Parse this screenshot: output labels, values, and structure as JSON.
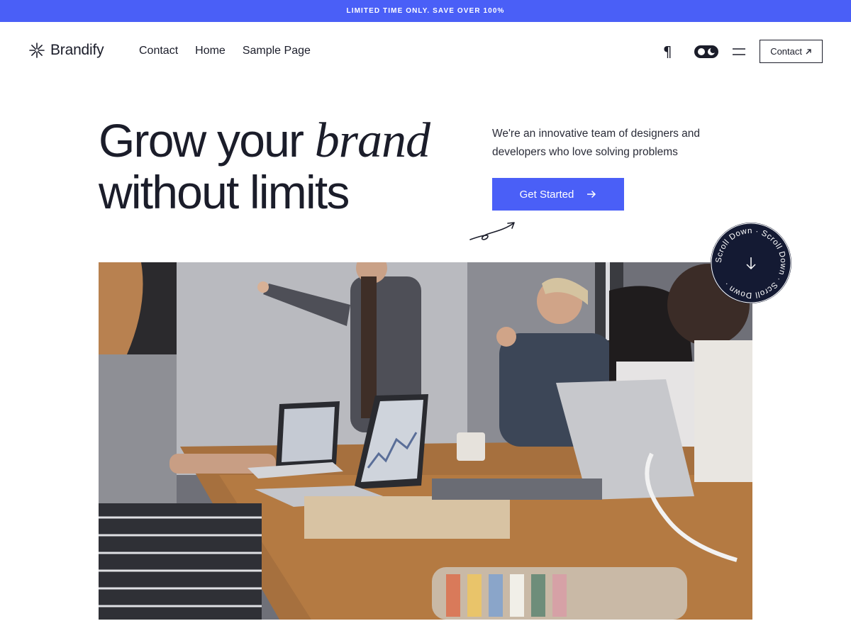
{
  "promo": {
    "text": "LIMITED TIME ONLY. SAVE OVER 100%"
  },
  "header": {
    "brand": "Brandify",
    "nav": [
      {
        "label": "Contact"
      },
      {
        "label": "Home"
      },
      {
        "label": "Sample Page"
      }
    ],
    "icons": {
      "pilcrow": "¶",
      "toggle": "dark-mode-toggle-icon",
      "menu": "menu-icon"
    },
    "contact_button": "Contact"
  },
  "hero": {
    "headline_part1": "Grow your ",
    "headline_italic": "brand",
    "headline_line2": "without limits",
    "intro": "We're an innovative team of designers and developers who love solving problems",
    "cta_label": "Get Started",
    "scroll_badge_text": "Scroll Down · Scroll Down · Scroll Down ·"
  },
  "colors": {
    "accent": "#4a5ff7",
    "text": "#1b1d2a",
    "badge": "#141a33"
  }
}
